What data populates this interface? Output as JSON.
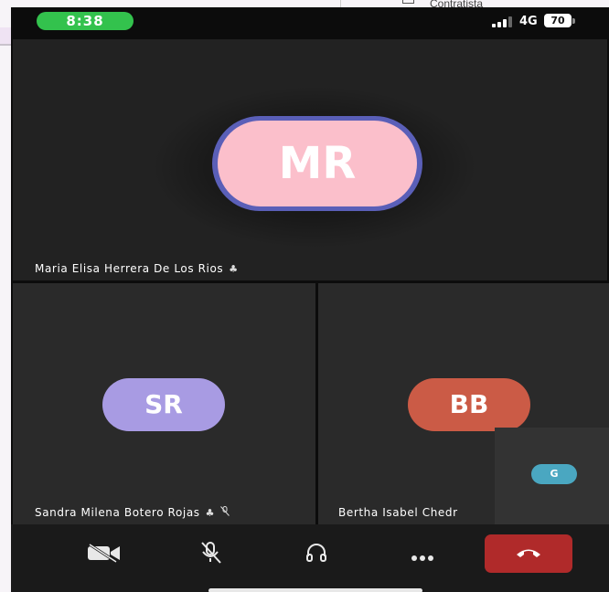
{
  "background": {
    "partial_text": "Contratista"
  },
  "status_bar": {
    "time": "8:38",
    "network": "4G",
    "battery": "70"
  },
  "participants": [
    {
      "initials": "MR",
      "name": "Maria Elisa Herrera De Los Rios",
      "color": "#fbbfcb"
    },
    {
      "initials": "SR",
      "name": "Sandra Milena Botero Rojas",
      "color": "#a89be3"
    },
    {
      "initials": "BB",
      "name": "Bertha Isabel Chedr",
      "color": "#cb5b46"
    }
  ],
  "self_view": {
    "initials": "G",
    "color": "#4aa7c1"
  },
  "controls": {
    "video": "video-off-icon",
    "mic": "mic-off-icon",
    "audio": "headphones-icon",
    "more": "more-icon",
    "end": "hang-up-icon",
    "end_color": "#b02a2a"
  }
}
